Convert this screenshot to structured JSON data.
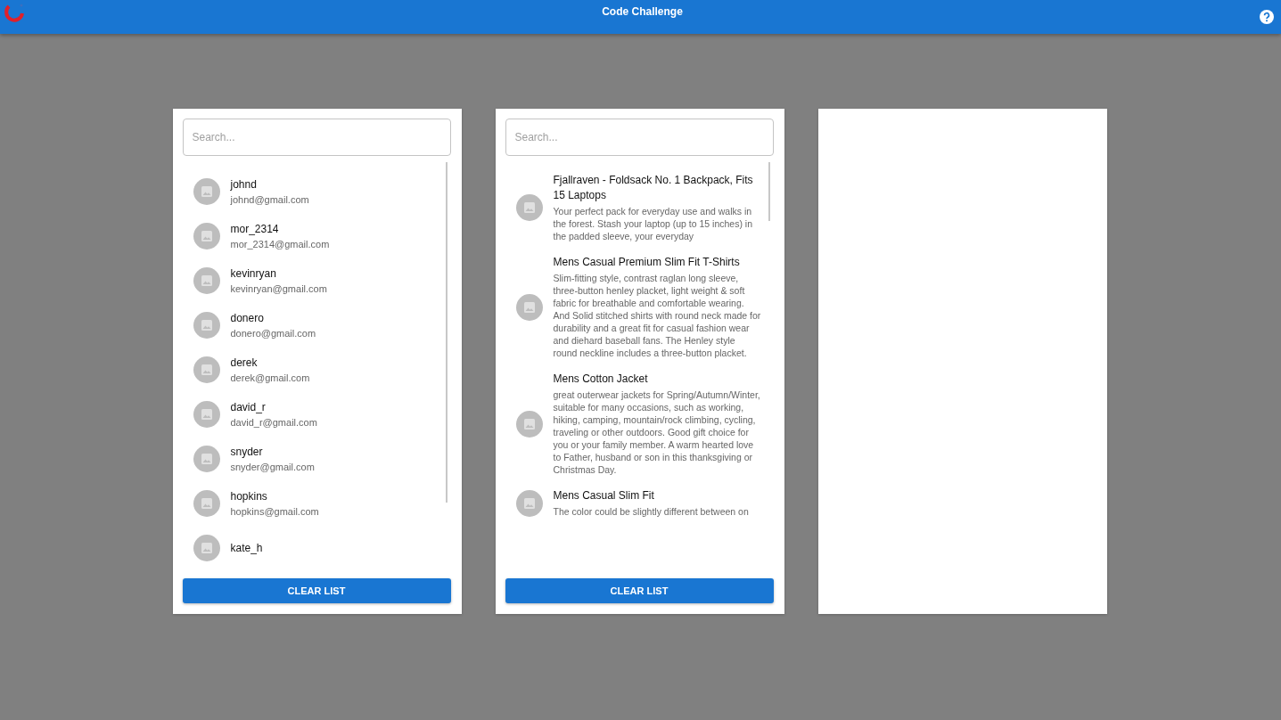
{
  "app_bar": {
    "title": "Code Challenge"
  },
  "users_panel": {
    "search": {
      "placeholder": "Search..."
    },
    "items": [
      {
        "name": "johnd",
        "email": "johnd@gmail.com"
      },
      {
        "name": "mor_2314",
        "email": "mor_2314@gmail.com"
      },
      {
        "name": "kevinryan",
        "email": "kevinryan@gmail.com"
      },
      {
        "name": "donero",
        "email": "donero@gmail.com"
      },
      {
        "name": "derek",
        "email": "derek@gmail.com"
      },
      {
        "name": "david_r",
        "email": "david_r@gmail.com"
      },
      {
        "name": "snyder",
        "email": "snyder@gmail.com"
      },
      {
        "name": "hopkins",
        "email": "hopkins@gmail.com"
      },
      {
        "name": "kate_h"
      }
    ],
    "button": "CLEAR LIST"
  },
  "products_panel": {
    "search": {
      "placeholder": "Search..."
    },
    "items": [
      {
        "name": "Fjallraven - Foldsack No. 1 Backpack, Fits 15 Laptops",
        "description": "Your perfect pack for everyday use and walks in the forest. Stash your laptop (up to 15 inches) in the padded sleeve, your everyday"
      },
      {
        "name": "Mens Casual Premium Slim Fit T-Shirts",
        "description": "Slim-fitting style, contrast raglan long sleeve, three-button henley placket, light weight & soft fabric for breathable and comfortable wearing. And Solid stitched shirts with round neck made for durability and a great fit for casual fashion wear and diehard baseball fans. The Henley style round neckline includes a three-button placket."
      },
      {
        "name": "Mens Cotton Jacket",
        "description": "great outerwear jackets for Spring/Autumn/Winter, suitable for many occasions, such as working, hiking, camping, mountain/rock climbing, cycling, traveling or other outdoors. Good gift choice for you or your family member. A warm hearted love to Father, husband or son in this thanksgiving or Christmas Day."
      },
      {
        "name": "Mens Casual Slim Fit",
        "description": "The color could be slightly different between on"
      }
    ],
    "button": "CLEAR LIST"
  }
}
